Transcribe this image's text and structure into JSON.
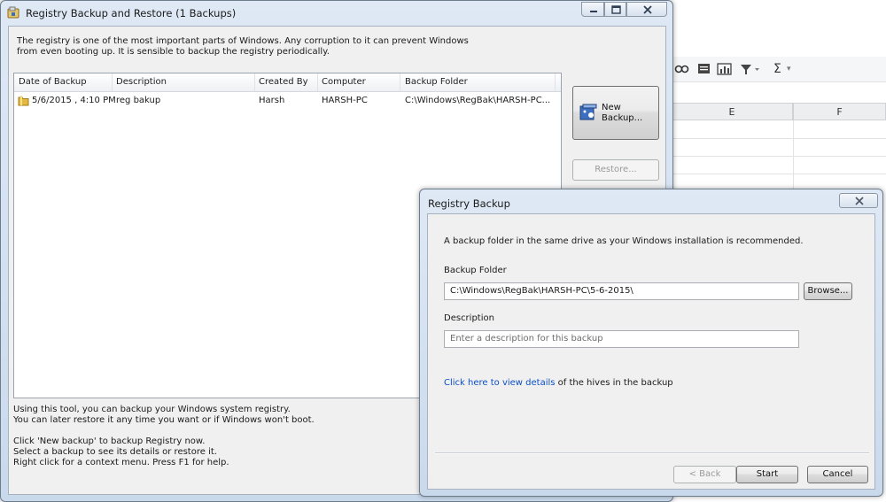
{
  "spreadsheet": {
    "toolbar_icons": [
      "link-icon",
      "comment-icon",
      "chart-icon",
      "filter-icon",
      "sum-icon"
    ],
    "col_e": "E",
    "col_f": "F",
    "sum_symbol": "Σ",
    "dropdown_arrow": "▾"
  },
  "main_window": {
    "title": "Registry Backup and Restore  (1 Backups)",
    "intro_line1": "The registry is one of the most important parts of Windows. Any corruption to it can prevent Windows",
    "intro_line2": "from even booting up.  It is sensible to backup the registry periodically.",
    "columns": [
      "Date of Backup",
      "Description",
      "Created By",
      "Computer",
      "Backup Folder"
    ],
    "rows": [
      {
        "date": "5/6/2015 , 4:10 PM",
        "description": "reg bakup",
        "created_by": "Harsh",
        "computer": "HARSH-PC",
        "folder": "C:\\Windows\\RegBak\\HARSH-PC..."
      }
    ],
    "new_backup_line1": "New",
    "new_backup_line2": "Backup...",
    "restore_label": "Restore...",
    "help_line1": "Using this tool, you can backup your Windows system registry.",
    "help_line2": "You can later restore it any time you want or if Windows won't boot.",
    "help_line3": "Click 'New backup' to backup Registry now.",
    "help_line4": "Select a backup to see its details or restore it.",
    "help_line5": "Right click for a context menu. Press F1 for help."
  },
  "dialog": {
    "title": "Registry Backup",
    "recommend_text": "A backup folder in the same drive as your Windows installation is recommended.",
    "folder_label": "Backup Folder",
    "folder_value": "C:\\Windows\\RegBak\\HARSH-PC\\5-6-2015\\",
    "browse_label": "Browse...",
    "description_label": "Description",
    "description_placeholder": "Enter a description for this backup",
    "details_link": "Click here to view details",
    "details_suffix": " of the hives in the backup",
    "back_label": "< Back",
    "start_label": "Start",
    "cancel_label": "Cancel"
  }
}
